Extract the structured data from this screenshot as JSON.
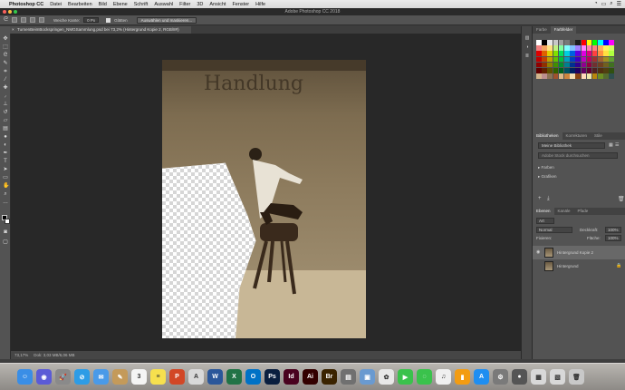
{
  "menubar": {
    "app_name": "Photoshop CC",
    "items": [
      "Datei",
      "Bearbeiten",
      "Bild",
      "Ebene",
      "Schrift",
      "Auswahl",
      "Filter",
      "3D",
      "Ansicht",
      "Fenster",
      "Hilfe"
    ]
  },
  "window": {
    "title": "Adobe Photoshop CC 2018"
  },
  "options": {
    "feather_label": "Weiche Kante:",
    "feather_value": "0 Px",
    "antialias_label": "Glätten",
    "select_mask_label": "Auswählen und maskieren..."
  },
  "document": {
    "tab_label": "TurnenBeimBockspringen_NMGSammlung.psd bei 73,2% (Hintergrund Kopie 2, RGB/8#)",
    "wall_text": "Handlung",
    "zoom": "73,17%",
    "doc_size": "Dok: 3,03 MB/6,06 MB"
  },
  "panels": {
    "colors": {
      "tabs": [
        "Farbe",
        "Farbfelder"
      ],
      "active_tab": "Farbfelder"
    },
    "libraries": {
      "tabs": [
        "Bibliotheken",
        "Korrekturen",
        "Stile"
      ],
      "active_tab": "Bibliotheken",
      "library_name": "Meine Bibliothek",
      "search_placeholder": "Adobe Stock durchsuchen",
      "groups": [
        "Farben",
        "Grafiken"
      ]
    },
    "layers": {
      "tabs": [
        "Ebenen",
        "Kanäle",
        "Pfade"
      ],
      "active_tab": "Ebenen",
      "filter_kind": "Art",
      "blend_mode": "Normal",
      "opacity_label": "Deckkraft:",
      "opacity_value": "100%",
      "lock_label": "Fixieren:",
      "fill_label": "Fläche:",
      "fill_value": "100%",
      "items": [
        {
          "name": "Hintergrund Kopie 2",
          "visible": true,
          "selected": true
        },
        {
          "name": "Hintergrund",
          "visible": false,
          "selected": false
        }
      ]
    }
  },
  "swatch_colors": [
    "#ffffff",
    "#000000",
    "#e8e8e8",
    "#c8c8c8",
    "#a0a0a0",
    "#787878",
    "#505050",
    "#1c1c1c",
    "#ff0000",
    "#ffff00",
    "#00ff00",
    "#00ffff",
    "#0000ff",
    "#ff00ff",
    "#f08080",
    "#f4a460",
    "#ffe080",
    "#c0f080",
    "#80ffa0",
    "#80ffff",
    "#80c0ff",
    "#a080ff",
    "#ff80ff",
    "#ff80b0",
    "#ff8080",
    "#ffb060",
    "#fff060",
    "#d0ff60",
    "#e00000",
    "#e06000",
    "#e0d000",
    "#80e000",
    "#00e060",
    "#00d0e0",
    "#0060e0",
    "#6000e0",
    "#e000e0",
    "#e00080",
    "#ff4040",
    "#ff9040",
    "#ffe040",
    "#b0ff40",
    "#c00000",
    "#c04000",
    "#c0a000",
    "#60c000",
    "#00c040",
    "#00a0c0",
    "#0040c0",
    "#4000c0",
    "#c000c0",
    "#c00060",
    "#a03030",
    "#a06030",
    "#a09020",
    "#60a030",
    "#900000",
    "#903000",
    "#908000",
    "#409000",
    "#009030",
    "#008090",
    "#003090",
    "#300090",
    "#900090",
    "#900040",
    "#703030",
    "#704020",
    "#706020",
    "#407020",
    "#600000",
    "#602000",
    "#605000",
    "#306000",
    "#006020",
    "#005060",
    "#002060",
    "#200060",
    "#600060",
    "#600030",
    "#502020",
    "#503010",
    "#504010",
    "#305010",
    "#d2b48c",
    "#bc8f8f",
    "#8b7355",
    "#a0522d",
    "#deb887",
    "#cd853f",
    "#f5deb3",
    "#8b4513",
    "#ffdab9",
    "#eee8aa",
    "#b8860b",
    "#6b8e23",
    "#556b2f",
    "#2f4f4f"
  ],
  "dock_apps": [
    {
      "name": "Finder",
      "label": "☺",
      "color": "#3a8ee6"
    },
    {
      "name": "Siri",
      "label": "◉",
      "color": "#5b5bd6"
    },
    {
      "name": "Launchpad",
      "label": "🚀",
      "color": "#8a8a8a"
    },
    {
      "name": "Safari",
      "label": "⊘",
      "color": "#2d9ce6"
    },
    {
      "name": "Mail",
      "label": "✉",
      "color": "#4a9ae8"
    },
    {
      "name": "Notes",
      "label": "✎",
      "color": "#c49a5a"
    },
    {
      "name": "Calendar",
      "label": "3",
      "color": "#f4f4f4"
    },
    {
      "name": "Stickies",
      "label": "≡",
      "color": "#f6e04e"
    },
    {
      "name": "PowerPoint",
      "label": "P",
      "color": "#d24726"
    },
    {
      "name": "Acrobat",
      "label": "A",
      "color": "#d9d9d9"
    },
    {
      "name": "Word",
      "label": "W",
      "color": "#2b579a"
    },
    {
      "name": "Excel",
      "label": "X",
      "color": "#217346"
    },
    {
      "name": "Outlook",
      "label": "O",
      "color": "#0072c6"
    },
    {
      "name": "Photoshop",
      "label": "Ps",
      "color": "#0a1f3f"
    },
    {
      "name": "InDesign",
      "label": "Id",
      "color": "#49021f"
    },
    {
      "name": "Illustrator",
      "label": "Ai",
      "color": "#330000"
    },
    {
      "name": "Bridge",
      "label": "Br",
      "color": "#3a2300"
    },
    {
      "name": "Archive",
      "label": "▤",
      "color": "#707070"
    },
    {
      "name": "Preview",
      "label": "▣",
      "color": "#6a9ad0"
    },
    {
      "name": "Photos",
      "label": "✿",
      "color": "#e8e8e8"
    },
    {
      "name": "FaceTime",
      "label": "▶",
      "color": "#3ac24c"
    },
    {
      "name": "Messages",
      "label": "◌",
      "color": "#3ac24c"
    },
    {
      "name": "Music",
      "label": "♫",
      "color": "#f0f0f0"
    },
    {
      "name": "Books",
      "label": "▮",
      "color": "#f39c12"
    },
    {
      "name": "App Store",
      "label": "A",
      "color": "#1f8ef1"
    },
    {
      "name": "System Preferences",
      "label": "⚙",
      "color": "#7a7a7a"
    },
    {
      "name": "Camera",
      "label": "●",
      "color": "#555555"
    },
    {
      "name": "Downloads",
      "label": "▦",
      "color": "#d8d8d8"
    },
    {
      "name": "Documents",
      "label": "▧",
      "color": "#d8d8d8"
    },
    {
      "name": "Trash",
      "label": "🗑",
      "color": "#c8c8c8"
    }
  ]
}
